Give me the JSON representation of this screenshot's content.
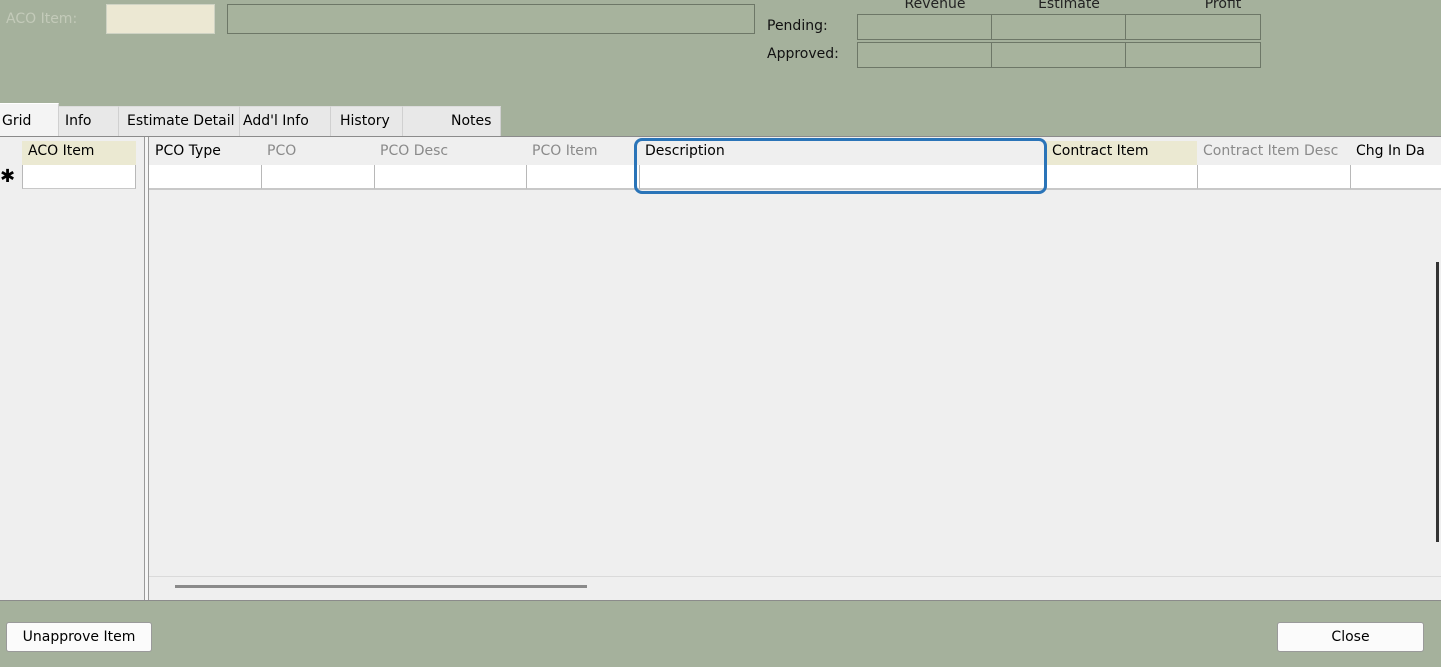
{
  "header": {
    "aco_item_label": "ACO Item:",
    "aco_item_value": "",
    "aco_description_value": ""
  },
  "summary": {
    "columns": [
      "Revenue",
      "Estimate",
      "Profit"
    ],
    "rows": [
      {
        "label": "Pending:",
        "values": [
          "",
          "",
          ""
        ]
      },
      {
        "label": "Approved:",
        "values": [
          "",
          "",
          ""
        ]
      }
    ]
  },
  "tabs": [
    {
      "label": "Grid",
      "active": true
    },
    {
      "label": "Info"
    },
    {
      "label": "Estimate Detail"
    },
    {
      "label": "Add'l Info"
    },
    {
      "label": "History"
    },
    {
      "label": "Notes"
    }
  ],
  "grid": {
    "frozen_column": "ACO Item",
    "columns": [
      "PCO Type",
      "PCO",
      "PCO Desc",
      "PCO Item",
      "Description",
      "Contract Item",
      "Contract Item Desc",
      "Chg In Da"
    ],
    "new_row_marker": "✱"
  },
  "buttons": {
    "unapprove": "Unapprove Item",
    "close": "Close"
  }
}
